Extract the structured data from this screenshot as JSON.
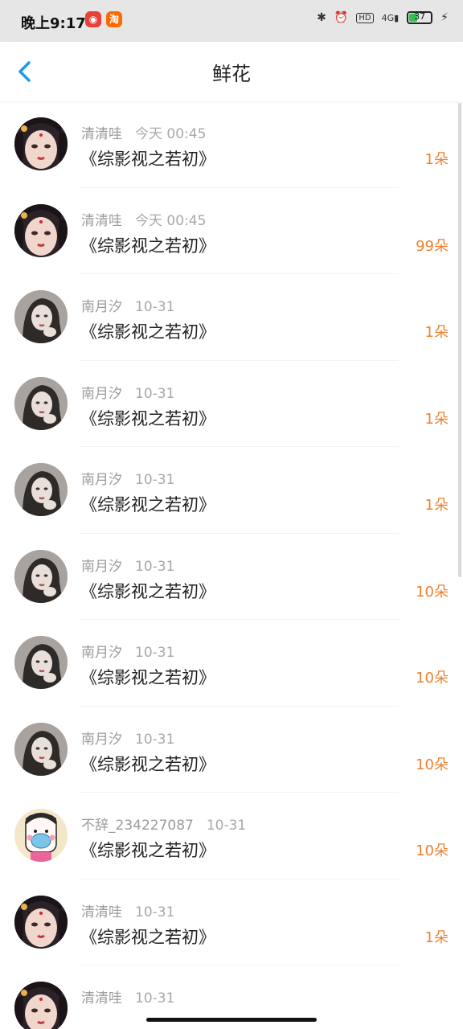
{
  "status": {
    "time": "晚上9:17",
    "apps": [
      {
        "icon": "weibo-icon",
        "glyph": "◉",
        "color": "#e8413a"
      },
      {
        "icon": "taobao-icon",
        "glyph": "淘",
        "color": "#ff6a00"
      }
    ],
    "right_icons": [
      "bluetooth-icon",
      "alarm-icon",
      "hd-icon",
      "signal-4g-icon"
    ],
    "battery": "37",
    "battery_level": 0.37,
    "bluetooth_glyph": "✱",
    "alarm_glyph": "⏰",
    "hd_glyph": "HD",
    "signal_glyph": "4G▮",
    "charging_glyph": "⚡"
  },
  "header": {
    "title": "鲜花"
  },
  "records": [
    {
      "user": "清清哇",
      "time": "今天 00:45",
      "book": "《综影视之若初》",
      "count": "1朵",
      "avatar": "avatar-ancient-woman"
    },
    {
      "user": "清清哇",
      "time": "今天 00:45",
      "book": "《综影视之若初》",
      "count": "99朵",
      "avatar": "avatar-ancient-woman"
    },
    {
      "user": "南月汐",
      "time": "10-31",
      "book": "《综影视之若初》",
      "count": "1朵",
      "avatar": "avatar-girl-bw"
    },
    {
      "user": "南月汐",
      "time": "10-31",
      "book": "《综影视之若初》",
      "count": "1朵",
      "avatar": "avatar-girl-bw"
    },
    {
      "user": "南月汐",
      "time": "10-31",
      "book": "《综影视之若初》",
      "count": "1朵",
      "avatar": "avatar-girl-bw"
    },
    {
      "user": "南月汐",
      "time": "10-31",
      "book": "《综影视之若初》",
      "count": "10朵",
      "avatar": "avatar-girl-bw"
    },
    {
      "user": "南月汐",
      "time": "10-31",
      "book": "《综影视之若初》",
      "count": "10朵",
      "avatar": "avatar-girl-bw"
    },
    {
      "user": "南月汐",
      "time": "10-31",
      "book": "《综影视之若初》",
      "count": "10朵",
      "avatar": "avatar-girl-bw"
    },
    {
      "user": "不辞_234227087",
      "time": "10-31",
      "book": "《综影视之若初》",
      "count": "10朵",
      "avatar": "avatar-cartoon-mask"
    },
    {
      "user": "清清哇",
      "time": "10-31",
      "book": "《综影视之若初》",
      "count": "1朵",
      "avatar": "avatar-ancient-woman"
    },
    {
      "user": "清清哇",
      "time": "10-31",
      "book": "",
      "count": "",
      "avatar": "avatar-ancient-woman"
    }
  ],
  "colors": {
    "accent": "#f0802e",
    "back": "#1e9be6"
  }
}
